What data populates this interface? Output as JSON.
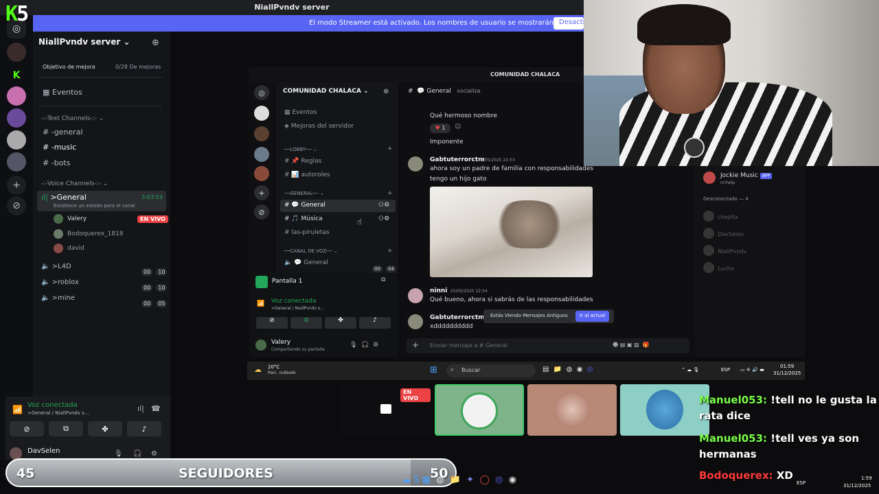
{
  "app_title": "NiallPvndv server",
  "streamer_banner": {
    "message": "El modo Streamer está activado. Los nombres de usuario se mostrarán de forma parcial.",
    "button": "Desactiva"
  },
  "overlay_logo": {
    "k": "K",
    "five": "5"
  },
  "sidebar": {
    "server_name": "NiallPvndv server",
    "goal_label": "Objetivo de mejora",
    "goal_progress": "0/28 De mejoras",
    "events": "Eventos",
    "text_category": "Text Channels",
    "text_channels": [
      "-general",
      "-music",
      "-bots"
    ],
    "voice_category": "Voice Channels",
    "voice_channels": [
      {
        "name": ">General",
        "timer": "3:03:53",
        "status": "Establece un estado para el canal"
      },
      {
        "name": ">L4D",
        "count_a": "00",
        "count_b": "10"
      },
      {
        "name": ">roblox",
        "count_a": "00",
        "count_b": "10"
      },
      {
        "name": ">mine",
        "count_a": "00",
        "count_b": "05"
      }
    ],
    "voice_users": [
      {
        "name": "Valery",
        "live": "EN VIVO"
      },
      {
        "name": "Bodoquerex_1818"
      },
      {
        "name": "david"
      }
    ]
  },
  "voice_panel": {
    "status": "Voz conectada",
    "location": ">General / NiallPvndv s...",
    "user": "DavSelen"
  },
  "inner": {
    "window_title": "COMUNIDAD CHALACA",
    "server_name": "COMUNIDAD CHALACA",
    "events": "Eventos",
    "boosts": "Mejoras del servidor",
    "categories": [
      "LOBBY",
      "GENERAL",
      "CANAL DE VOZ"
    ],
    "lobby_channels": [
      "Reglas",
      "autoroles"
    ],
    "general_channels": [
      "General",
      "Música",
      "las-piruletas"
    ],
    "voice_channels": [
      {
        "name": "General",
        "a": "00",
        "b": "04"
      }
    ],
    "screen_share": "Pantalla 1",
    "voice_status": "Voz conectada",
    "voice_location": ">General / NiallPvndv s...",
    "panel_user": "Valery",
    "panel_user_status": "Compartiendo su pantalla",
    "chat_header": "General",
    "chat_topic": "socializa",
    "messages": [
      {
        "text": "Qué hermoso nombre"
      },
      {
        "reaction": "1"
      },
      {
        "text": "Imponente"
      },
      {
        "author": "Gabtuterrorctm",
        "time": "25/05/2025 22:53",
        "lines": [
          "ahora soy un padre de familia con responsabilidades",
          "tengo un hijo gato"
        ]
      },
      {
        "author": "ninni",
        "time": "25/05/2025 22:54",
        "lines": [
          "Qué bueno, ahora si sabrás de las responsabilidades"
        ]
      },
      {
        "author": "Gabtuterrorctm",
        "lines": [
          "xdddddddddd"
        ]
      }
    ],
    "old_messages_notice": "Estás Viendo Mensajes Antiguos",
    "jump_button": "Ir al actual",
    "input_placeholder": "Enviar mensaje a # General",
    "members": {
      "bot_name": "Jockie Music",
      "bot_tag": "APP",
      "bot_status": "m!help",
      "offline_header": "Desconectado — 4",
      "offline": [
        "chepita",
        "DavSelen",
        "NiallPvndv",
        "Lucho"
      ]
    },
    "taskbar": {
      "weather_temp": "20°C",
      "weather_desc": "Parc. nublado",
      "search": "Buscar",
      "lang": "ESP",
      "time": "01:59",
      "date": "31/12/2025"
    }
  },
  "tiles": {
    "live": "EN VIVO"
  },
  "chat": [
    {
      "user": "Manuel053:",
      "text": "!tell no le gusta la rata dice"
    },
    {
      "user": "Manuel053:",
      "text": "!tell ves ya son hermanas"
    },
    {
      "user": "Bodoquerex:",
      "text": "XD"
    }
  ],
  "follow_goal": {
    "current": "45",
    "label": "SEGUIDORES",
    "target": "50",
    "progress": 0.9
  },
  "bottom_taskbar": {
    "lang": "ESP",
    "time": "1:59",
    "date": "31/12/2025"
  },
  "colors": {
    "accent": "#5865f2",
    "live": "#ed4245",
    "voice": "#23a55a",
    "chat_user": "#7cfc4a"
  }
}
